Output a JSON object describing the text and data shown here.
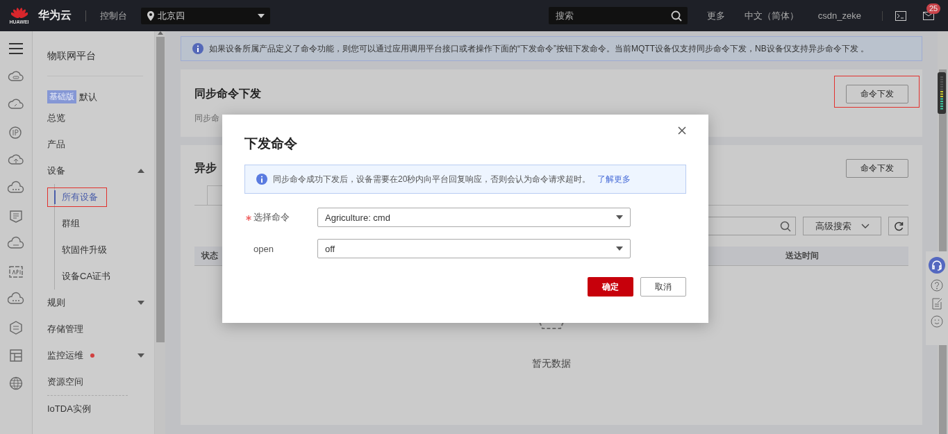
{
  "top_bar": {
    "logo_caption": "HUAWEI",
    "brand": "华为云",
    "console": "控制台",
    "region": "北京四",
    "search": {
      "placeholder": "搜索"
    },
    "links": [
      "更多",
      "中文（简体）",
      "csdn_zeke"
    ],
    "mail_badge": "25"
  },
  "sidebar": {
    "title": "物联网平台",
    "edition_badge": "基础版",
    "edition_name": "默认",
    "items": [
      {
        "label": "总览",
        "selected": false
      },
      {
        "label": "产品",
        "selected": false
      },
      {
        "label": "设备",
        "selected": false,
        "expanded": true,
        "children": [
          {
            "label": "所有设备",
            "selected": true,
            "highlighted": true
          },
          {
            "label": "群组",
            "selected": false
          },
          {
            "label": "软固件升级",
            "selected": false
          },
          {
            "label": "设备CA证书",
            "selected": false
          }
        ]
      },
      {
        "label": "规则",
        "selected": false,
        "expanded": false
      },
      {
        "label": "存储管理",
        "selected": false
      },
      {
        "label": "监控运维",
        "selected": false,
        "expanded": false,
        "alert": true
      },
      {
        "label": "资源空间",
        "selected": false
      },
      {
        "label": "IoTDA实例",
        "selected": false,
        "divider_before": true
      }
    ]
  },
  "notice": "如果设备所属产品定义了命令功能，则您可以通过应用调用平台接口或者操作下面的“下发命令”按钮下发命令。当前MQTT设备仅支持同步命令下发，NB设备仅支持异步命令下发 。",
  "sync_section": {
    "title": "同步命令下发",
    "description": "同步命",
    "button": "命令下发",
    "button_highlighted": true
  },
  "async_section": {
    "title": "异步",
    "button": "命令下发",
    "advanced_search": "高级搜索",
    "table": {
      "columns": [
        "状态",
        "送达时间"
      ]
    },
    "empty_text": "暂无数据"
  },
  "dialog": {
    "title": "下发命令",
    "alert": "同步命令成功下发后，设备需要在20秒内向平台回复响应，否则会认为命令请求超时。",
    "alert_link": "了解更多",
    "fields": [
      {
        "label": "选择命令",
        "required": true,
        "value": "Agriculture: cmd"
      },
      {
        "label": "open",
        "required": false,
        "value": "off"
      }
    ],
    "buttons": [
      {
        "label": "确定",
        "kind": "primary"
      },
      {
        "label": "取消",
        "kind": "default"
      }
    ]
  }
}
